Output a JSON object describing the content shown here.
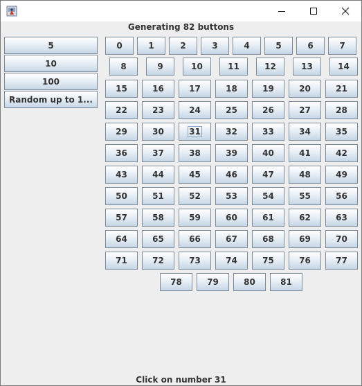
{
  "window": {
    "minimize_glyph": "—",
    "maximize_glyph": "□",
    "close_glyph": "✕"
  },
  "header": {
    "text": "Generating 82 buttons"
  },
  "side_buttons": [
    "5",
    "10",
    "100",
    "Random up to 1..."
  ],
  "number_buttons": [
    "0",
    "1",
    "2",
    "3",
    "4",
    "5",
    "6",
    "7",
    "8",
    "9",
    "10",
    "11",
    "12",
    "13",
    "14",
    "15",
    "16",
    "17",
    "18",
    "19",
    "20",
    "21",
    "22",
    "23",
    "24",
    "25",
    "26",
    "27",
    "28",
    "29",
    "30",
    "31",
    "32",
    "33",
    "34",
    "35",
    "36",
    "37",
    "38",
    "39",
    "40",
    "41",
    "42",
    "43",
    "44",
    "45",
    "46",
    "47",
    "48",
    "49",
    "50",
    "51",
    "52",
    "53",
    "54",
    "55",
    "56",
    "57",
    "58",
    "59",
    "60",
    "61",
    "62",
    "63",
    "64",
    "65",
    "66",
    "67",
    "68",
    "69",
    "70",
    "71",
    "72",
    "73",
    "74",
    "75",
    "76",
    "77",
    "78",
    "79",
    "80",
    "81"
  ],
  "focused_button": "31",
  "status": {
    "text": "Click on number 31"
  }
}
